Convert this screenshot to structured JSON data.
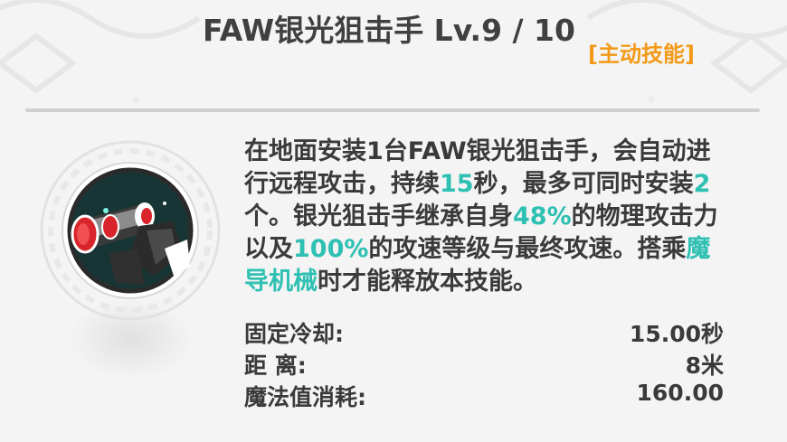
{
  "skill": {
    "title": "FAW银光狙击手 Lv.9 / 10",
    "type_tag": "[主动技能]",
    "icon": "sniper-turret-icon"
  },
  "description": [
    {
      "text": "在地面安装1台FAW银光狙击手，会自动进行远程攻击，持续",
      "highlight": false
    },
    {
      "text": "15",
      "highlight": true
    },
    {
      "text": "秒，最多可同时安装",
      "highlight": false
    },
    {
      "text": "2",
      "highlight": true
    },
    {
      "text": "个。银光狙击手继承自身",
      "highlight": false
    },
    {
      "text": "48%",
      "highlight": true
    },
    {
      "text": "的物理攻击力以及",
      "highlight": false
    },
    {
      "text": "100%",
      "highlight": true
    },
    {
      "text": "的攻速等级与最终攻速。搭乘",
      "highlight": false
    },
    {
      "text": "魔导机械",
      "highlight": true
    },
    {
      "text": "时才能释放本技能。",
      "highlight": false
    }
  ],
  "stats": [
    {
      "label": "固定冷却:",
      "value": "15.00秒"
    },
    {
      "label": "距 离:",
      "value": "8米"
    },
    {
      "label": "魔法值消耗:",
      "value": "160.00"
    }
  ],
  "colors": {
    "highlight": "#2ec0b3",
    "type_tag": "#f29a18",
    "text": "#3a3a3a"
  }
}
